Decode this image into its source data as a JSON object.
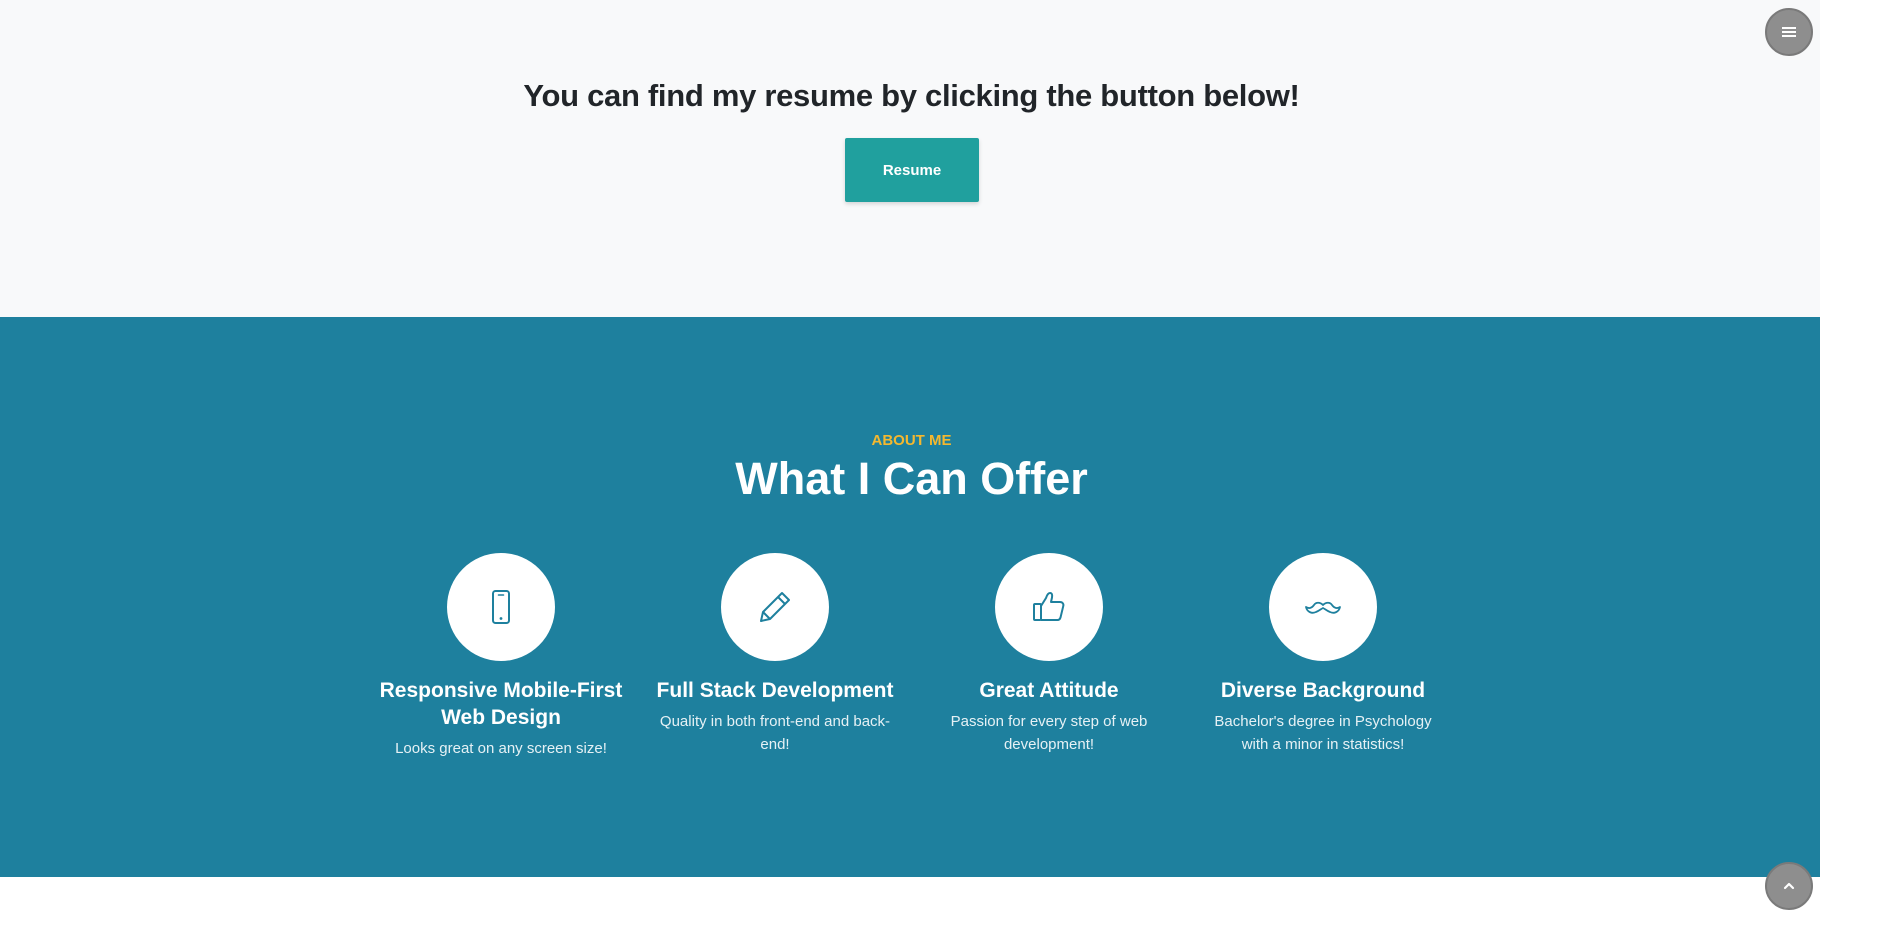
{
  "resume": {
    "heading": "You can find my resume by clicking the button below!",
    "button_label": "Resume"
  },
  "about": {
    "eyebrow": "ABOUT ME",
    "title": "What I Can Offer",
    "features": [
      {
        "icon": "mobile-phone-icon",
        "title": "Responsive Mobile-First Web Design",
        "text": "Looks great on any screen size!"
      },
      {
        "icon": "pencil-icon",
        "title": "Full Stack Development",
        "text": "Quality in both front-end and back-end!"
      },
      {
        "icon": "thumbs-up-icon",
        "title": "Great Attitude",
        "text": "Passion for every step of web development!"
      },
      {
        "icon": "mustache-icon",
        "title": "Diverse Background",
        "text": "Bachelor's degree in Psychology with a minor in statistics!"
      }
    ]
  },
  "controls": {
    "menu_icon": "hamburger-menu-icon",
    "scroll_top_icon": "chevron-up-icon"
  },
  "colors": {
    "accent_teal": "#20a09e",
    "about_background": "#1e809e",
    "eyebrow_yellow": "#f5b82e",
    "light_background": "#f8f9fa"
  }
}
